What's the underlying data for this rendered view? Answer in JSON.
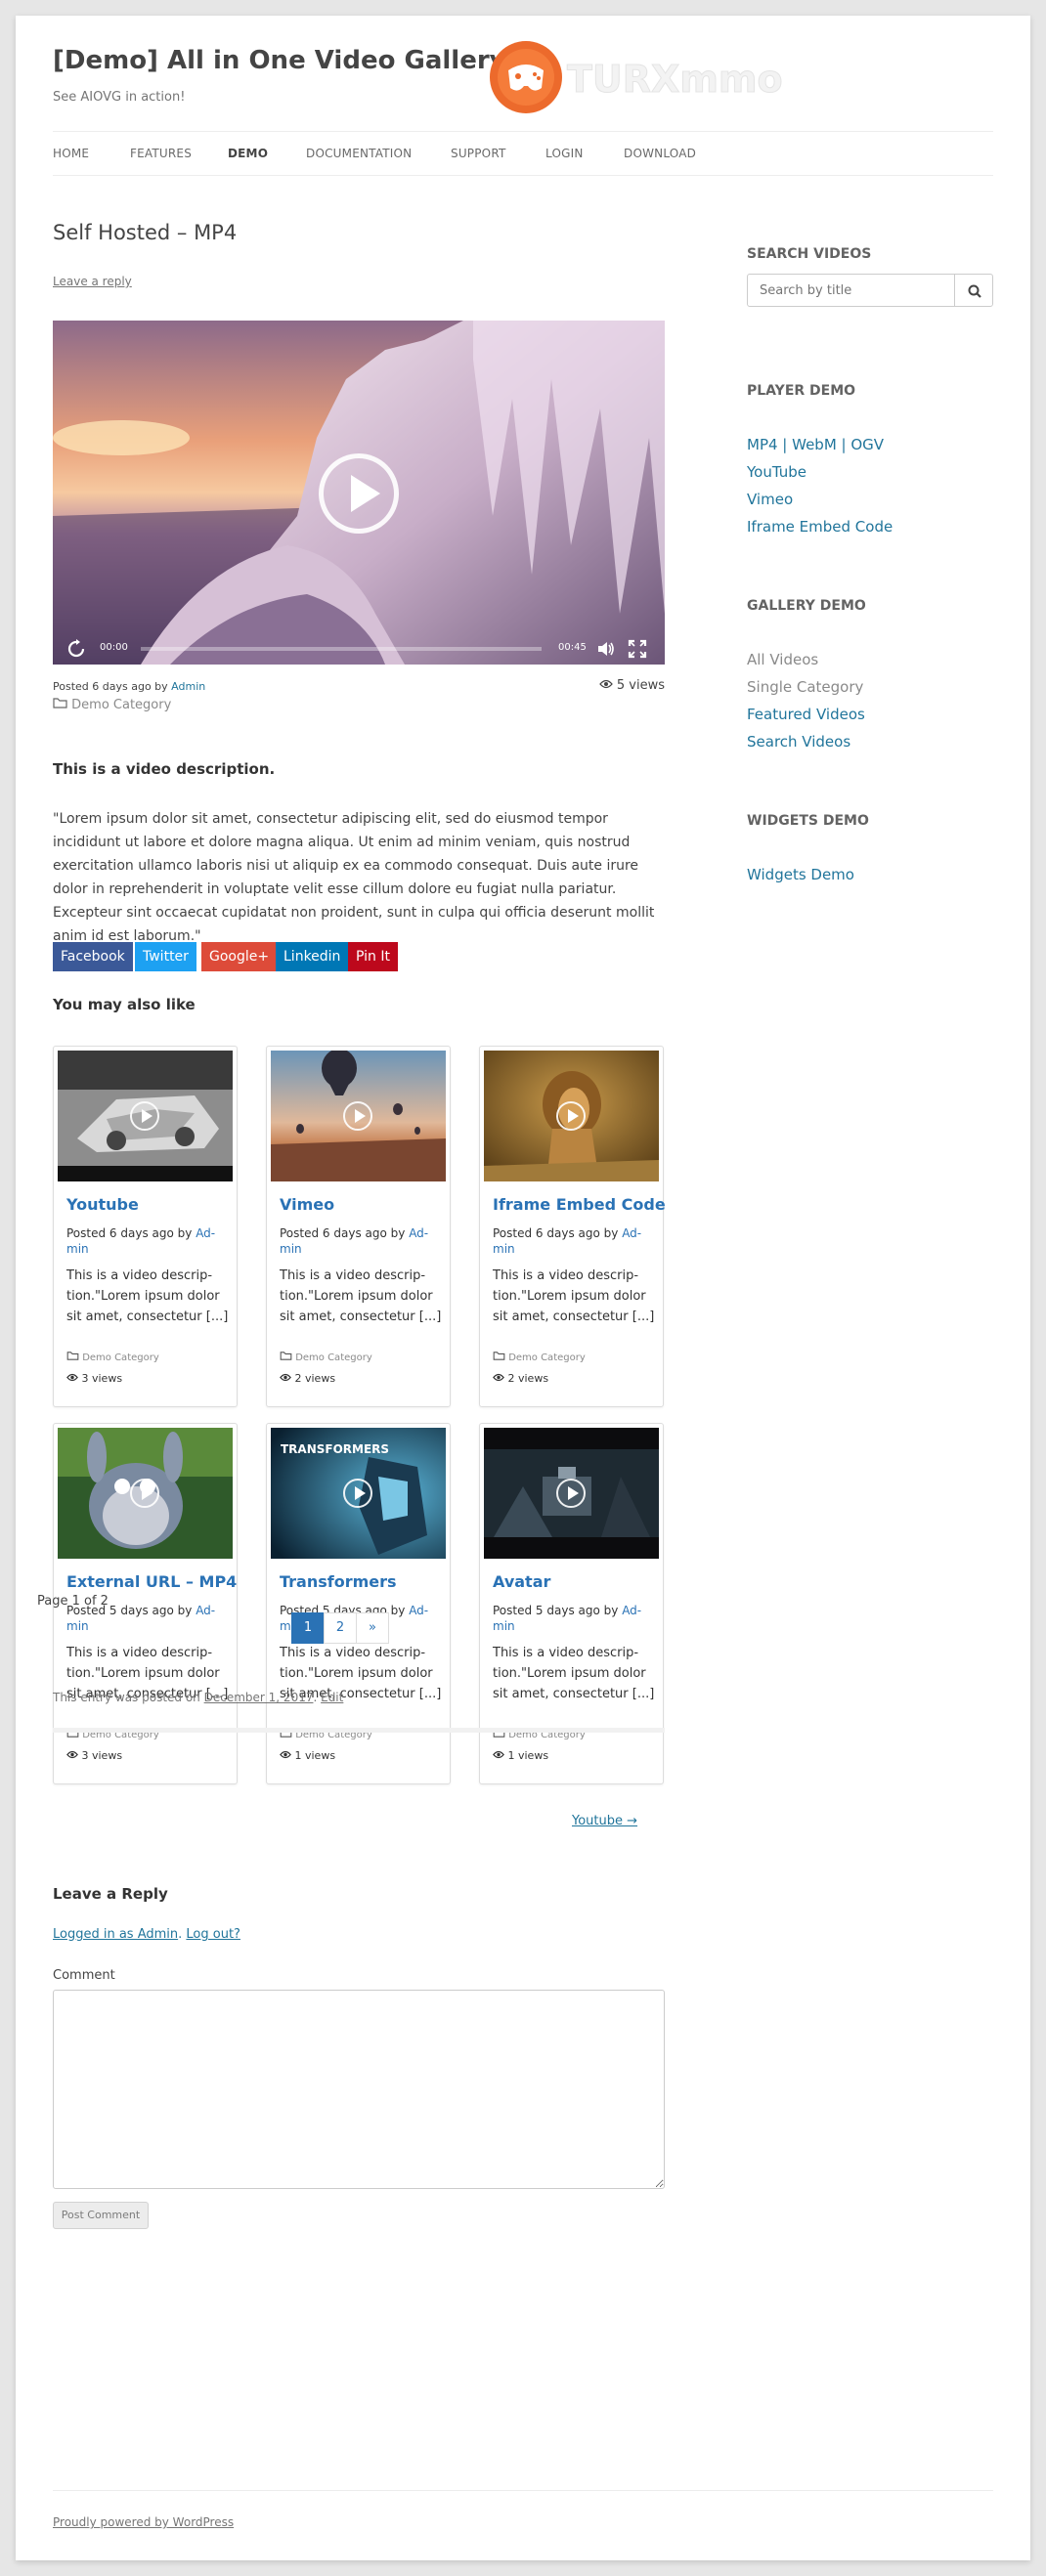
{
  "header": {
    "site_title": "[Demo] All in One Video Gallery",
    "tagline": "See AIOVG in action!",
    "logo_text": "TURXmmo"
  },
  "nav": {
    "items": [
      "HOME",
      "FEATURES",
      "DEMO",
      "DOCUMENTATION",
      "SUPPORT",
      "LOGIN",
      "DOWNLOAD"
    ],
    "active": "DEMO"
  },
  "post": {
    "title": "Self Hosted – MP4",
    "leave_reply": "Leave a reply",
    "player": {
      "current_time": "00:00",
      "duration": "00:45",
      "progress": 0
    },
    "meta_prefix": "Posted 6 days ago by",
    "author": "Admin",
    "views": "5 views",
    "category": "Demo Category",
    "description_title": "This is a video description.",
    "description": "\"Lorem ipsum dolor sit amet, consectetur adipiscing elit, sed do eiusmod tempor incididunt ut labore et dolore magna aliqua. Ut enim ad minim veniam, quis nostrud exercitation ullamco laboris nisi ut aliquip ex ea commodo consequat. Duis aute irure dolor in reprehenderit in voluptate velit esse cillum dolore eu fugiat nulla pariatur. Excepteur sint occaecat cupidatat non proident, sunt in culpa qui officia deserunt mollit anim id est laborum.\""
  },
  "share": {
    "buttons": [
      {
        "label": "Facebook",
        "color": "#3b5998"
      },
      {
        "label": "Twitter",
        "color": "#1da1f2"
      },
      {
        "label": "Google+",
        "color": "#dd4b39"
      },
      {
        "label": "Linkedin",
        "color": "#0077b5"
      },
      {
        "label": "Pin It",
        "color": "#bd081c"
      }
    ]
  },
  "related": {
    "heading": "You may also like",
    "cards": [
      {
        "title": "Youtube",
        "posted": "Posted 6 days ago by",
        "author": "Ad-min",
        "desc": "This is a video descrip-tion.\"Lorem ipsum dolor sit amet, consectetur [...]",
        "category": "Demo Category",
        "views": "3 views"
      },
      {
        "title": "Vimeo",
        "posted": "Posted 6 days ago by",
        "author": "Ad-min",
        "desc": "This is a video descrip-tion.\"Lorem ipsum dolor sit amet, consectetur [...]",
        "category": "Demo Category",
        "views": "2 views"
      },
      {
        "title": "Iframe Embed Code",
        "posted": "Posted 6 days ago by",
        "author": "Ad-min",
        "desc": "This is a video descrip-tion.\"Lorem ipsum dolor sit amet, consectetur [...]",
        "category": "Demo Category",
        "views": "2 views"
      },
      {
        "title": "External URL – MP4",
        "posted": "Posted 5 days ago by",
        "author": "Ad-min",
        "desc": "This is a video descrip-tion.\"Lorem ipsum dolor sit amet, consectetur [...]",
        "category": "Demo Category",
        "views": "3 views"
      },
      {
        "title": "Transformers",
        "posted": "Posted 5 days ago by",
        "author": "Ad-min",
        "desc": "This is a video descrip-tion.\"Lorem ipsum dolor sit amet, consectetur [...]",
        "category": "Demo Category",
        "views": "1 views"
      },
      {
        "title": "Avatar",
        "posted": "Posted 5 days ago by",
        "author": "Ad-min",
        "desc": "This is a video descrip-tion.\"Lorem ipsum dolor sit amet, consectetur [...]",
        "category": "Demo Category",
        "views": "1 views"
      }
    ],
    "thumb_overlay": {
      "transformers": "TRANSFORMERS"
    }
  },
  "pagination": {
    "info": "Page 1 of 2",
    "pages": [
      "1",
      "2",
      "»"
    ],
    "current": "1"
  },
  "entry_meta": {
    "text": "This entry was posted on",
    "date": "December 1, 2017",
    "edit": "Edit"
  },
  "post_nav": {
    "next": "Youtube →"
  },
  "comments": {
    "title": "Leave a Reply",
    "logged_in": "Logged in as Admin",
    "logout": "Log out?",
    "comment_label": "Comment",
    "submit": "Post Comment"
  },
  "sidebar": {
    "search_title": "SEARCH VIDEOS",
    "search_placeholder": "Search by title",
    "player_title": "PLAYER DEMO",
    "player_links": [
      "MP4 | WebM | OGV",
      "YouTube",
      "Vimeo",
      "Iframe Embed Code"
    ],
    "gallery_title": "GALLERY DEMO",
    "gallery_links": [
      "All Videos",
      "Single Category",
      "Featured Videos",
      "Search Videos"
    ],
    "widgets_title": "WIDGETS DEMO",
    "widgets_links": [
      "Widgets Demo"
    ]
  },
  "footer": {
    "credit": "Proudly powered by WordPress"
  }
}
